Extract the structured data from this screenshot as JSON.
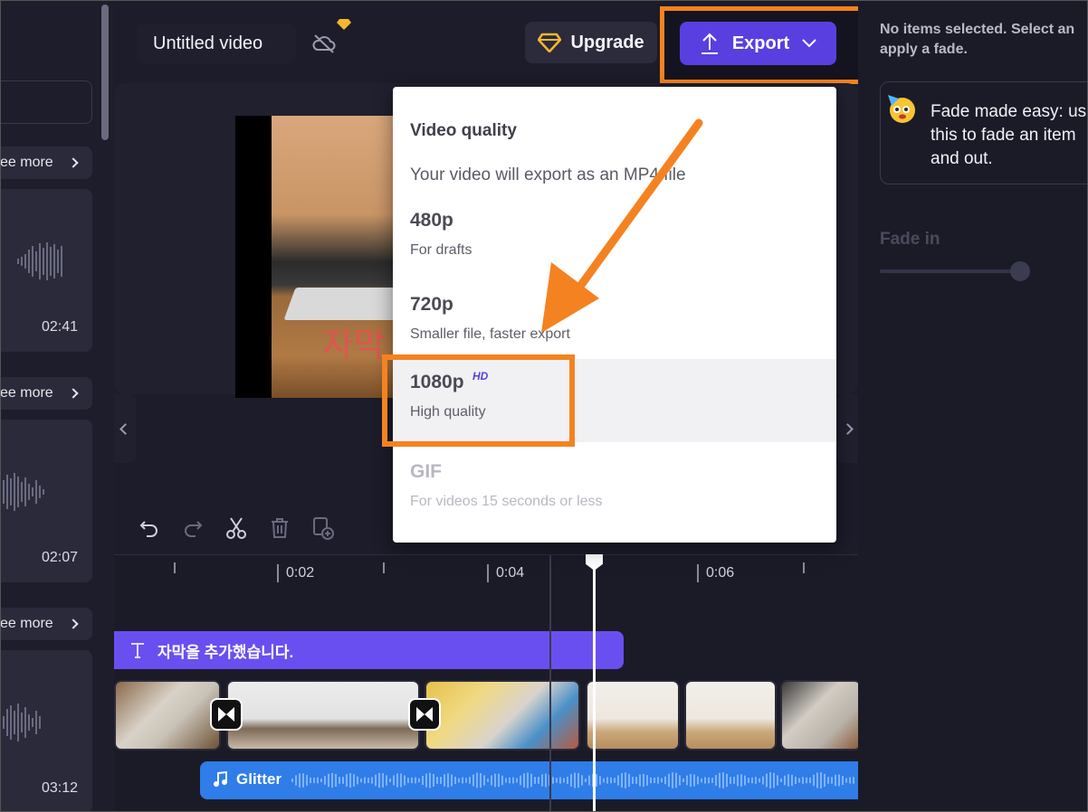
{
  "left_panel": {
    "see_more_label": "ee more",
    "durations": [
      "02:41",
      "02:07",
      "03:12"
    ]
  },
  "header": {
    "title": "Untitled video",
    "upgrade_label": "Upgrade",
    "export_label": "Export"
  },
  "preview": {
    "caption": "자막"
  },
  "timeline": {
    "ruler": [
      "0:02",
      "0:04",
      "0:06"
    ],
    "text_clip": "자막을 추가했습니다.",
    "audio_clip": "Glitter"
  },
  "right_panel": {
    "info": "No items selected. Select an\napply a fade.",
    "tip": "Fade made easy: us\nthis to fade an item\nand out.",
    "fade_in_label": "Fade in"
  },
  "export_menu": {
    "heading": "Video quality",
    "subheading": "Your video will export as an MP4 file",
    "options": [
      {
        "name": "480p",
        "desc": "For drafts"
      },
      {
        "name": "720p",
        "desc": "Smaller file, faster export"
      },
      {
        "name": "1080p",
        "badge": "HD",
        "desc": "High quality"
      },
      {
        "name": "GIF",
        "desc": "For videos 15 seconds or less"
      }
    ],
    "selected": "1080p"
  },
  "colors": {
    "accent": "#5a3fe0",
    "highlight": "#f58220",
    "audio": "#2f7de8",
    "text_track": "#6a4ff0"
  },
  "icons": [
    "cloud-off-icon",
    "diamond-icon",
    "upload-icon",
    "chevron-down-icon",
    "undo-icon",
    "redo-icon",
    "scissors-icon",
    "trash-icon",
    "duplicate-icon",
    "text-icon",
    "music-note-icon",
    "transition-icon",
    "chevron-left-icon",
    "chevron-right-icon"
  ]
}
